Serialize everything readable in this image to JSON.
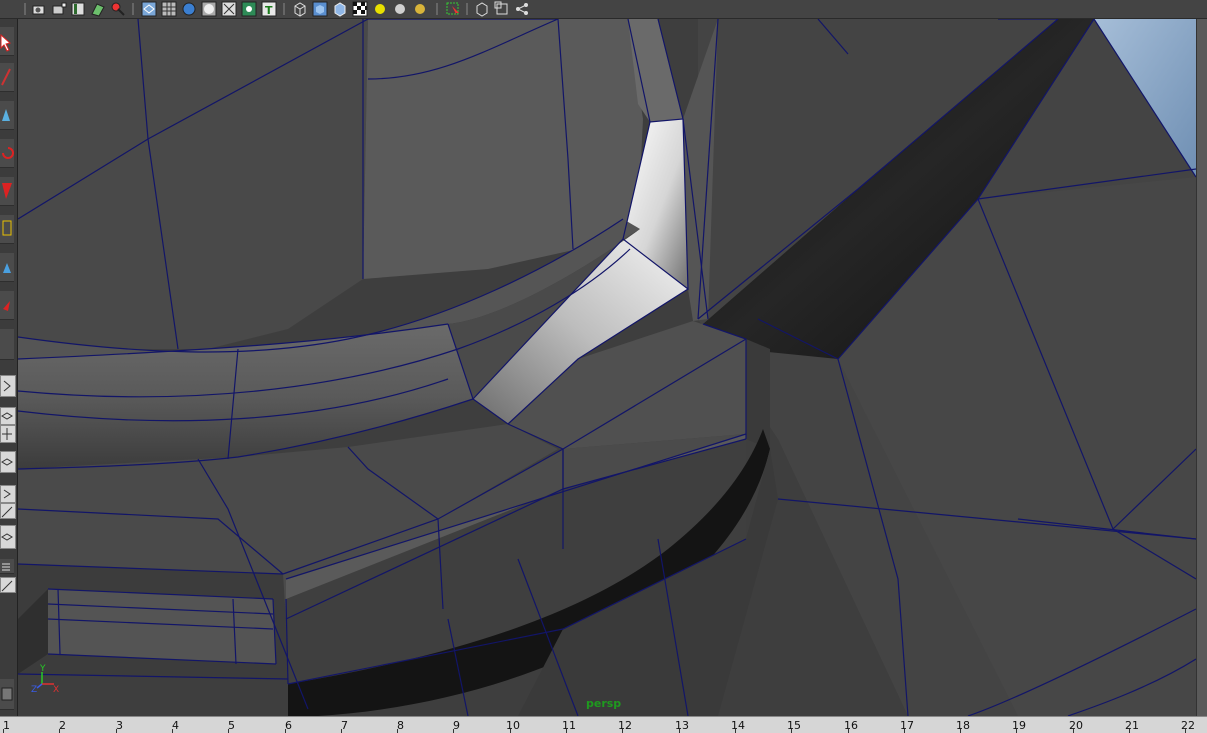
{
  "viewport": {
    "camera_label": "persp"
  },
  "axis_gizmo": {
    "y": "Y",
    "z": "Z",
    "x": "X"
  },
  "ruler": {
    "ticks": [
      "1",
      "2",
      "3",
      "4",
      "5",
      "6",
      "7",
      "8",
      "9",
      "10",
      "11",
      "12",
      "13",
      "14",
      "15",
      "16",
      "17",
      "18",
      "19",
      "20",
      "21",
      "22"
    ]
  },
  "colors": {
    "wire": "#121568",
    "panel": "#444444",
    "ruler_bg": "#d6d6d6",
    "persp_green": "#1f9a1f"
  }
}
